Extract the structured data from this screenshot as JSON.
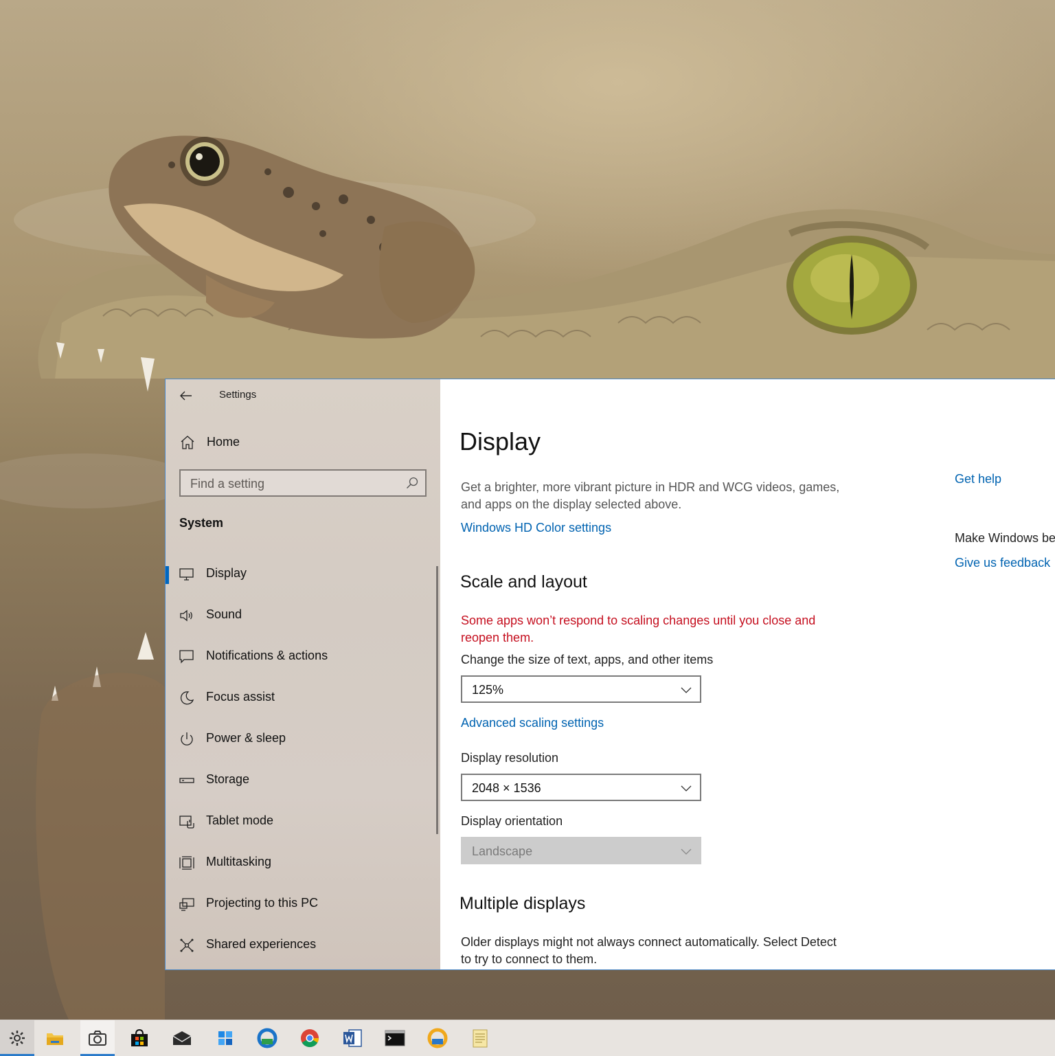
{
  "window": {
    "app_title": "Settings"
  },
  "nav": {
    "home_label": "Home",
    "search_placeholder": "Find a setting",
    "group_label": "System",
    "items": [
      {
        "label": "Display",
        "icon": "monitor-icon",
        "active": true
      },
      {
        "label": "Sound",
        "icon": "speaker-icon"
      },
      {
        "label": "Notifications & actions",
        "icon": "notification-icon"
      },
      {
        "label": "Focus assist",
        "icon": "moon-icon"
      },
      {
        "label": "Power & sleep",
        "icon": "power-icon"
      },
      {
        "label": "Storage",
        "icon": "storage-icon"
      },
      {
        "label": "Tablet mode",
        "icon": "tablet-mode-icon"
      },
      {
        "label": "Multitasking",
        "icon": "multitasking-icon"
      },
      {
        "label": "Projecting to this PC",
        "icon": "projecting-icon"
      },
      {
        "label": "Shared experiences",
        "icon": "shared-experiences-icon"
      }
    ]
  },
  "content": {
    "page_title": "Display",
    "hdr_description": "Get a brighter, more vibrant picture in HDR and WCG videos, games, and apps on the display selected above.",
    "hdr_link": "Windows HD Color settings",
    "scale_heading": "Scale and layout",
    "scale_warning": "Some apps won’t respond to scaling changes until you close and reopen them.",
    "scale_label": "Change the size of text, apps, and other items",
    "scale_value": "125%",
    "advanced_scaling_link": "Advanced scaling settings",
    "resolution_label": "Display resolution",
    "resolution_value": "2048 × 1536",
    "orientation_label": "Display orientation",
    "orientation_value": "Landscape",
    "multiple_heading": "Multiple displays",
    "multiple_description": "Older displays might not always connect automatically. Select Detect to try to connect to them."
  },
  "side": {
    "get_help": "Get help",
    "make_windows_better": "Make Windows be",
    "give_feedback": "Give us feedback"
  },
  "colors": {
    "accent": "#0067c0",
    "link": "#0063b1",
    "warning": "#c50f1f"
  },
  "taskbar": {
    "apps": [
      "settings-icon",
      "file-explorer-icon",
      "camera-icon",
      "store-icon",
      "mail-icon",
      "app-icon",
      "edge-dev-icon",
      "chrome-icon",
      "word-icon",
      "command-prompt-icon",
      "edge-canary-icon",
      "notepad-icon"
    ]
  }
}
